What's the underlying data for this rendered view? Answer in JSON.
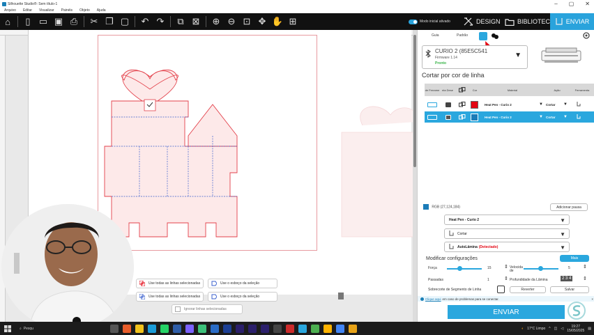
{
  "window": {
    "title": "Silhouette Studio®: Sem título-1",
    "controls": [
      "–",
      "▢",
      "✕"
    ]
  },
  "menu": [
    "Arquivo",
    "Editar",
    "Visualizar",
    "Painéis",
    "Objeto",
    "Ajuda"
  ],
  "toolbar": {
    "mode_label": "Modo inicial ativado",
    "design": "DESIGN",
    "library": "BIBLIOTECA",
    "send": "ENVIAR"
  },
  "panel": {
    "tabs": [
      "Guia",
      "Padrão"
    ],
    "device": {
      "name": "CURIO 2 (85E5C541",
      "firmware": "Firmware 1.14",
      "status": "Pronto"
    },
    "section_title": "Cortar por cor de linha",
    "table": {
      "headers": [
        "de Ferrame",
        "nta Dese",
        "Cor",
        "Material",
        "Ação",
        "Ferramenta"
      ],
      "rows": [
        {
          "material": "Heat Pen - Curio 2",
          "action": "Cortar",
          "color": "#e30613"
        },
        {
          "material": "Heat Pen - Curio 2",
          "action": "Cortar",
          "color": "#1b7cb8"
        }
      ]
    },
    "rgb_label": "RGB (27,124,184)",
    "rgb_color": "#1b7cb8",
    "add_pause": "Adicionar pausa",
    "material_select": "Heat Pen - Curio 2",
    "action_select": "Cortar",
    "blade_label": "AutoLâmina",
    "blade_status": "(Detectado)",
    "modify_title": "Modificar configurações",
    "more": "Mais",
    "settings": {
      "force_label": "Força",
      "force_value": "15",
      "speed_label": "Velocida de",
      "speed_value": "5",
      "passes_label": "Passadas",
      "passes_value": "1",
      "depth_label": "Profundidade da Lâmina",
      "depth_value": "2 3 4",
      "overcut_label": "Sobrecorte de Segmento de Linha",
      "revert": "Reverter",
      "save": "Salvar"
    },
    "info_link": "Clique aqui",
    "info_text": "em caso de problemas para se conectar.",
    "send_button": "ENVIAR"
  },
  "selection_buttons": {
    "use_all_lines_1": "Use todas as linhas selecionadas",
    "use_sketch_1": "Use o esboço da seleção",
    "use_all_lines_2": "Use todas as linhas selecionadas",
    "use_sketch_2": "Use o esboço da seleção",
    "ignore_lines": "Ignorar linhas selecionadas"
  },
  "taskbar": {
    "search": "Pesqu",
    "weather": "17°C Limpo",
    "time": "19:27",
    "date": "15/05/2025"
  }
}
